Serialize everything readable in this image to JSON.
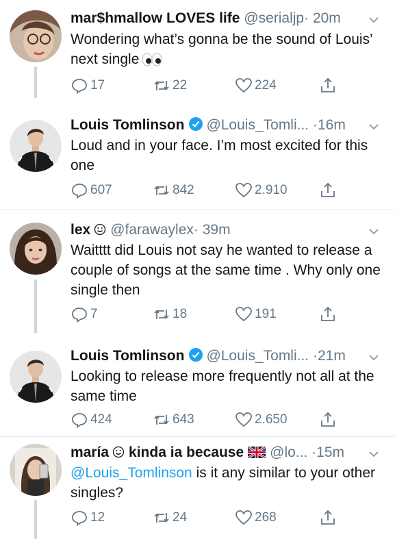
{
  "tweets": [
    {
      "name": "mar$hmallow LOVES life",
      "handle": "@serialjp",
      "time": "20m",
      "text": "Wondering what’s gonna be the sound of Louis’ next single",
      "replies": "17",
      "retweets": "22",
      "likes": "224",
      "avatar_icon": "avatar-girl-glasses",
      "emoji": "eyes"
    },
    {
      "name": "Louis Tomlinson",
      "handle": "@Louis_Tomli...",
      "time": "16m",
      "text": "Loud and in your face. I’m most excited for this one",
      "replies": "607",
      "retweets": "842",
      "likes": "2.910",
      "avatar_icon": "avatar-man-black-jacket",
      "verified": true
    },
    {
      "name": "lex",
      "handle": "@farawaylex",
      "time": "39m",
      "text": "Waitttt did Louis not say he wanted to release a couple of songs at the same time . Why only one single then",
      "replies": "7",
      "retweets": "18",
      "likes": "191",
      "avatar_icon": "avatar-girl-dark-hair",
      "emoji": "smiley"
    },
    {
      "name": "Louis Tomlinson",
      "handle": "@Louis_Tomli...",
      "time": "21m",
      "text": "Looking to release more frequently not all at the same time",
      "replies": "424",
      "retweets": "643",
      "likes": "2.650",
      "avatar_icon": "avatar-man-black-jacket",
      "verified": true
    },
    {
      "name": "maría",
      "name_suffix": "kinda ia because",
      "handle": "@lo...",
      "time": "15m",
      "mention": "@Louis_Tomlinson",
      "text": " is it any similar to your other singles?",
      "replies": "12",
      "retweets": "24",
      "likes": "268",
      "avatar_icon": "avatar-girl-mirror-selfie",
      "emoji": "smiley",
      "flag": "uk-flag"
    }
  ],
  "separator": "·",
  "colors": {
    "link": "#1da1f2",
    "muted": "#657786",
    "verified": "#1da1f2",
    "thread": "#ccd6dd"
  }
}
